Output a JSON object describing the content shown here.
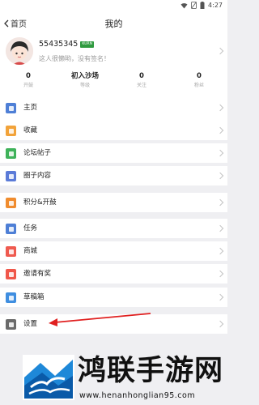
{
  "status_bar": {
    "time": "4:27",
    "icons": [
      "wifi-icon",
      "no-sim-icon",
      "battery-icon"
    ]
  },
  "nav": {
    "back_label": "首页",
    "title": "我的"
  },
  "profile": {
    "username": "55435345",
    "badge": "KURN",
    "signature": "这人很懒哟，没有签名！"
  },
  "stats": [
    {
      "value": "0",
      "label": "开鼓"
    },
    {
      "value": "初入沙场",
      "label": "等级"
    },
    {
      "value": "0",
      "label": "关注"
    },
    {
      "value": "0",
      "label": "粉丝"
    }
  ],
  "menu": [
    {
      "label": "主页",
      "color": "#4e7fd6",
      "icon": "home-icon"
    },
    {
      "label": "收藏",
      "color": "#f2a33a",
      "icon": "favorite-icon"
    },
    {
      "label": "论坛帖子",
      "color": "#3fb25a",
      "icon": "forum-post-icon"
    },
    {
      "label": "圈子内容",
      "color": "#5b7bd8",
      "icon": "circle-icon"
    },
    {
      "label": "积分&开鼓",
      "color": "#f08c2e",
      "icon": "points-icon"
    },
    {
      "label": "任务",
      "color": "#4e7fd6",
      "icon": "task-icon"
    },
    {
      "label": "商城",
      "color": "#ef5a4f",
      "icon": "store-icon"
    },
    {
      "label": "邀请有奖",
      "color": "#f0574a",
      "icon": "gift-icon"
    },
    {
      "label": "草稿箱",
      "color": "#3f8ee0",
      "icon": "draft-icon"
    },
    {
      "label": "设置",
      "color": "#6a6a6a",
      "icon": "settings-icon"
    }
  ],
  "annotation": {
    "arrow_color": "#e02020"
  },
  "watermark": {
    "title": "鸿联手游网",
    "url": "www.henanhonglian95.com"
  }
}
